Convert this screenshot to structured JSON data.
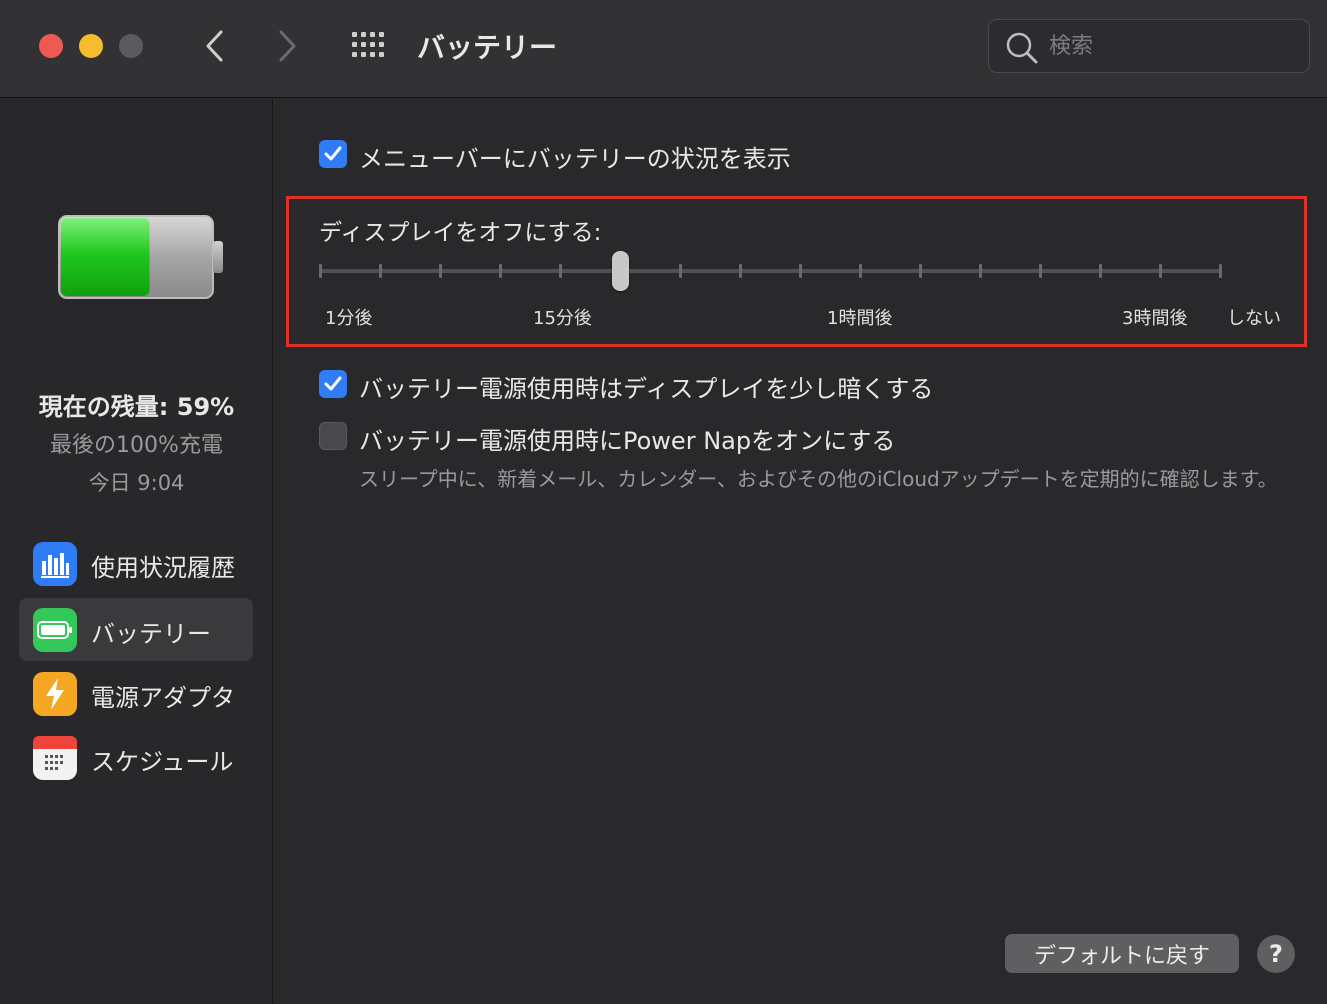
{
  "window": {
    "title": "バッテリー",
    "search_placeholder": "検索"
  },
  "sidebar": {
    "level_main": "現在の残量: 59%",
    "level_sub": "最後の100%充電",
    "level_time": "今日 9:04",
    "battery_fraction": 0.59,
    "items": [
      {
        "label": "使用状況履歴",
        "icon": "bar-chart-icon",
        "color": "#2f7cf6",
        "active": false
      },
      {
        "label": "バッテリー",
        "icon": "battery-icon",
        "color": "#34c759",
        "active": true
      },
      {
        "label": "電源アダプタ",
        "icon": "lightning-icon",
        "color": "#f5a623",
        "active": false
      },
      {
        "label": "スケジュール",
        "icon": "calendar-icon",
        "color": "#f2f2f2",
        "active": false
      }
    ]
  },
  "main": {
    "show_in_menubar": {
      "label": "メニューバーにバッテリーの状況を表示",
      "checked": true
    },
    "display_off": {
      "title": "ディスプレイをオフにする:",
      "tick_count": 16,
      "selected_tick": 5,
      "labels": [
        "1分後",
        "15分後",
        "1時間後",
        "3時間後",
        "しない"
      ]
    },
    "dim_display": {
      "label": "バッテリー電源使用時はディスプレイを少し暗くする",
      "checked": true
    },
    "power_nap": {
      "label": "バッテリー電源使用時にPower Napをオンにする",
      "checked": false
    },
    "power_nap_desc": "スリープ中に、新着メール、カレンダー、およびその他のiCloudアップデートを定期的に確認します。",
    "restore_defaults": "デフォルトに戻す",
    "help": "?"
  },
  "colors": {
    "accent": "#2f7cf6",
    "highlight": "#e0302a",
    "battery_green": "#2ecc2e"
  }
}
